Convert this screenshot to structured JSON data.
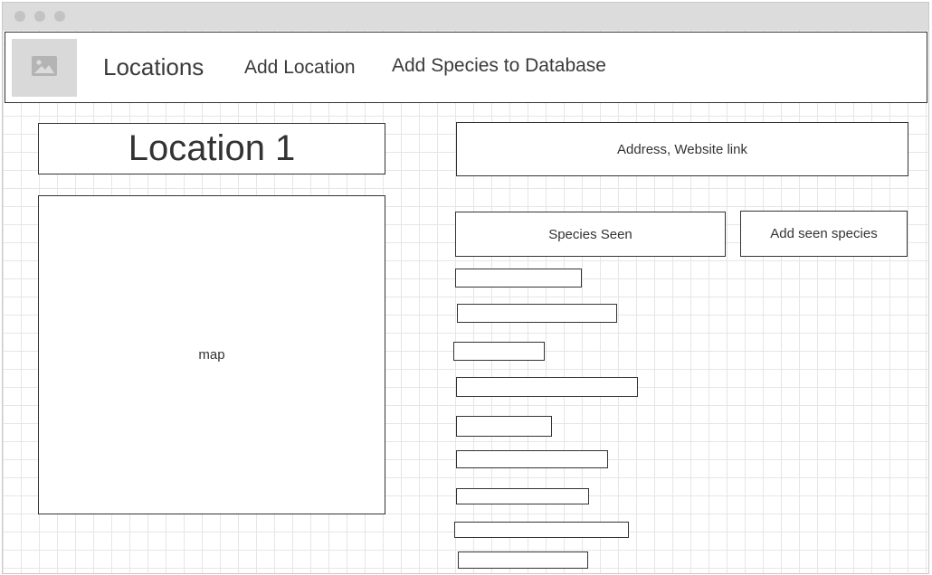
{
  "nav": {
    "logo_icon": "image-placeholder-icon",
    "locations_label": "Locations",
    "add_location_label": "Add Location",
    "add_species_label": "Add Species to Database"
  },
  "location": {
    "title": "Location 1",
    "map_label": "map",
    "address_label": "Address, Website link"
  },
  "species": {
    "seen_label": "Species Seen",
    "add_seen_label": "Add seen species",
    "list_count": 9
  },
  "colors": {
    "border": "#333333",
    "grid": "#e6e6e6",
    "titlebar": "#dcdcdc",
    "placeholder": "#d9d9d9"
  }
}
